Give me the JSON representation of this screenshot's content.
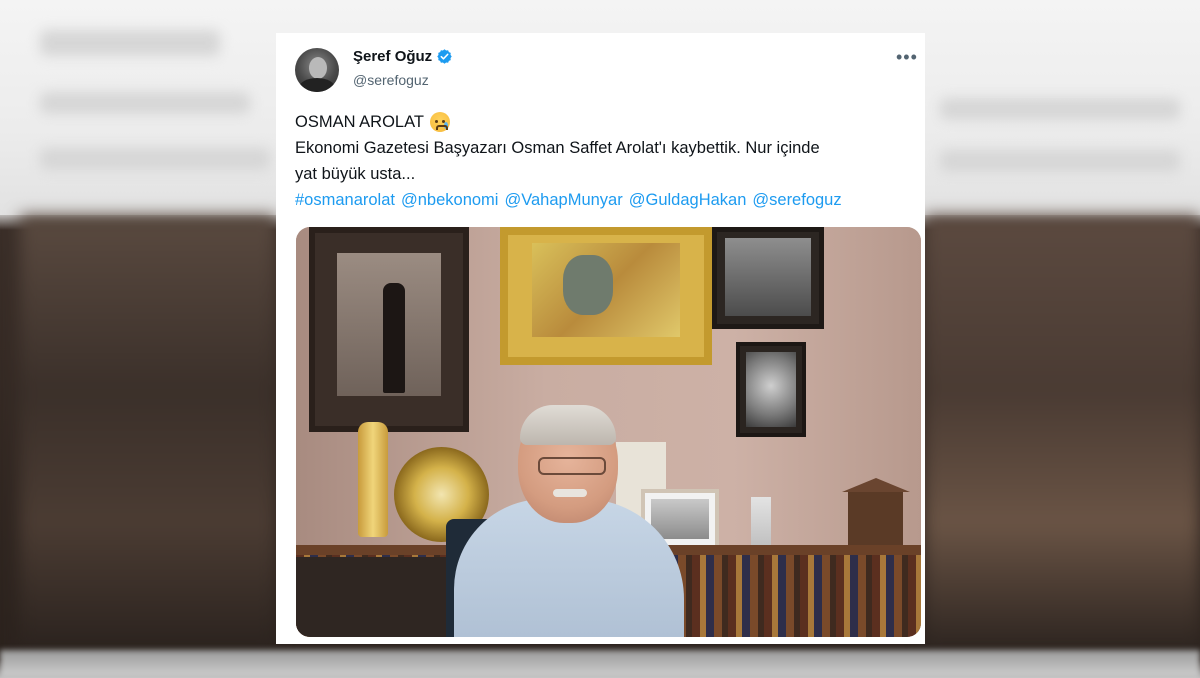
{
  "tweet": {
    "display_name": "Şeref Oğuz",
    "handle": "@serefoguz",
    "more_label": "•••",
    "title_line": "OSMAN AROLAT",
    "title_emoji": "crying-face-emoji",
    "body_line_1": "Ekonomi Gazetesi Başyazarı Osman Saffet Arolat'ı kaybettik. Nur içinde",
    "body_line_2": "yat büyük usta...",
    "hashtags": [
      "#osmanarolat",
      "@nbekonomi",
      "@VahapMunyar",
      "@GuldagHakan",
      "@serefoguz"
    ]
  },
  "icons": {
    "verified": "verified-badge-icon",
    "more": "more-options-icon"
  },
  "colors": {
    "link": "#1d9bf0",
    "text": "#0f1419",
    "secondary_text": "#536471",
    "verified": "#1d9bf0"
  }
}
